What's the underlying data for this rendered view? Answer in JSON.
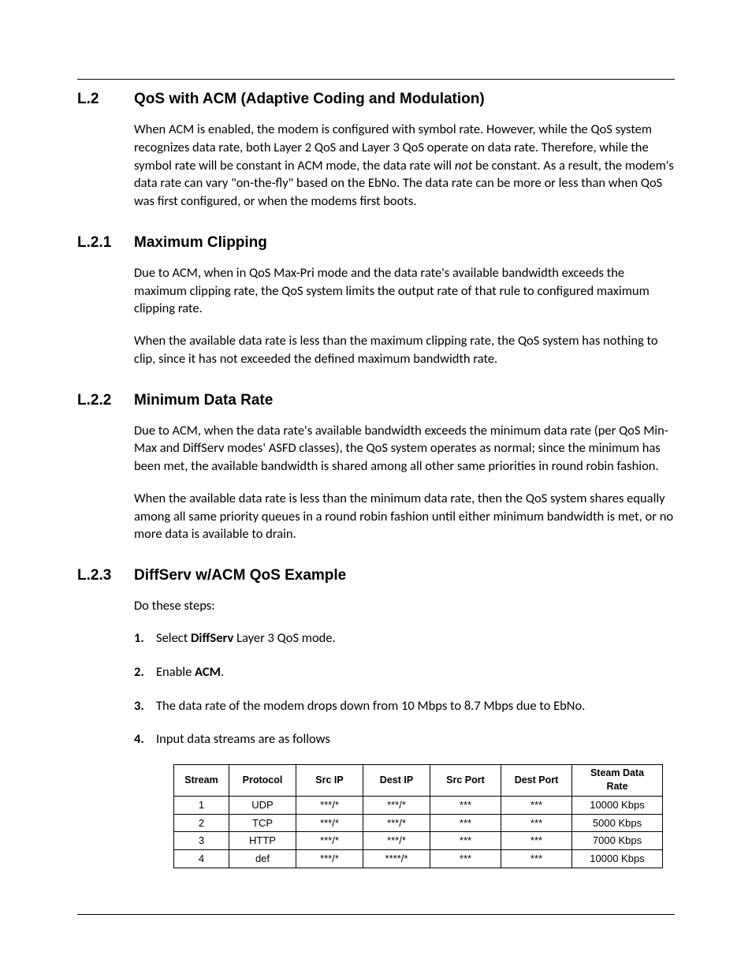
{
  "sections": {
    "l2": {
      "num": "L.2",
      "title": "QoS with ACM (Adaptive Coding and Modulation)",
      "p1a": "When ACM is enabled, the modem is configured with symbol rate. However, while the QoS system recognizes data rate, both Layer 2 QoS and Layer 3 QoS operate on data rate. Therefore, while the symbol rate will be constant in ACM mode, the data rate will ",
      "p1_italic": "not",
      "p1b": " be constant. As a result, the modem's data rate can vary \"on-the-fly\" based on the EbNo. The data rate can be more or less than when QoS was first configured, or when the modems first boots."
    },
    "l21": {
      "num": "L.2.1",
      "title": "Maximum Clipping",
      "p1": "Due to ACM, when in QoS Max-Pri mode and the data rate's available bandwidth exceeds the maximum clipping rate, the QoS system limits the output rate of that rule to configured maximum clipping rate.",
      "p2": "When the available data rate is less than the maximum clipping rate, the QoS system has nothing to clip, since it has not exceeded the defined maximum bandwidth rate."
    },
    "l22": {
      "num": "L.2.2",
      "title": "Minimum Data Rate",
      "p1": "Due to ACM, when the data rate's available bandwidth exceeds the minimum data rate (per QoS Min-Max and DiffServ modes' ASFD classes), the QoS system operates as normal; since the minimum has been met, the available bandwidth is shared among all other same priorities in round robin fashion.",
      "p2": "When the available data rate is less than the minimum data rate, then the QoS system shares equally among all same priority queues in a round robin fashion until either minimum bandwidth is met, or no more data is available to drain."
    },
    "l23": {
      "num": "L.2.3",
      "title": "DiffServ w/ACM QoS Example",
      "intro": "Do these steps:",
      "steps": {
        "s1": {
          "num": "1.",
          "pre": "Select ",
          "bold": "DiffServ",
          "post": " Layer 3 QoS mode."
        },
        "s2": {
          "num": "2.",
          "pre": "Enable ",
          "bold": "ACM",
          "post": "."
        },
        "s3": {
          "num": "3.",
          "text": "The data rate of the modem drops down from 10 Mbps to 8.7 Mbps due to EbNo."
        },
        "s4": {
          "num": "4.",
          "text": "Input data streams are as follows"
        }
      }
    }
  },
  "table": {
    "headers": {
      "stream": "Stream",
      "protocol": "Protocol",
      "srcip": "Src IP",
      "destip": "Dest IP",
      "srcport": "Src Port",
      "destport": "Dest Port",
      "rate": "Steam Data Rate"
    },
    "rows": [
      {
        "stream": "1",
        "protocol": "UDP",
        "srcip": "***/*",
        "destip": "***/*",
        "srcport": "***",
        "destport": "***",
        "rate": "10000 Kbps"
      },
      {
        "stream": "2",
        "protocol": "TCP",
        "srcip": "***/*",
        "destip": "***/*",
        "srcport": "***",
        "destport": "***",
        "rate": "5000 Kbps"
      },
      {
        "stream": "3",
        "protocol": "HTTP",
        "srcip": "***/*",
        "destip": "***/*",
        "srcport": "***",
        "destport": "***",
        "rate": "7000 Kbps"
      },
      {
        "stream": "4",
        "protocol": "def",
        "srcip": "***/*",
        "destip": "****/*",
        "srcport": "***",
        "destport": "***",
        "rate": "10000 Kbps"
      }
    ]
  }
}
